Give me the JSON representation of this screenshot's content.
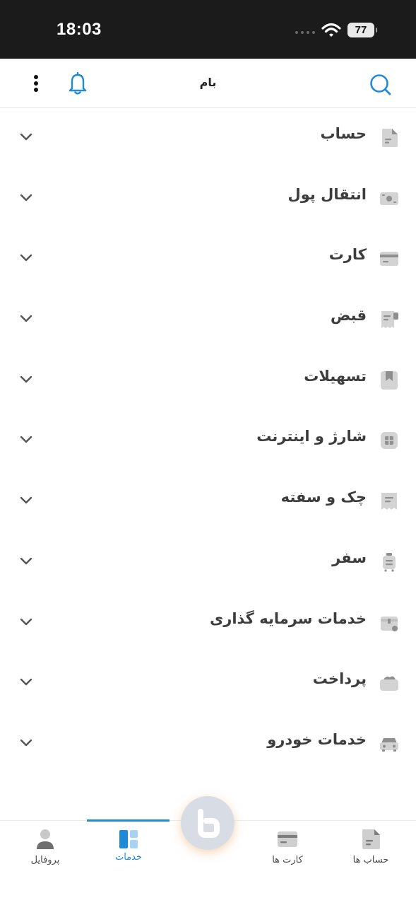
{
  "status_bar": {
    "time": "18:03",
    "battery": "77"
  },
  "header": {
    "title": "بام"
  },
  "menu": [
    {
      "label": "حساب",
      "icon": "document-icon"
    },
    {
      "label": "انتقال پول",
      "icon": "money-transfer-icon"
    },
    {
      "label": "کارت",
      "icon": "card-icon"
    },
    {
      "label": "قبض",
      "icon": "bill-icon"
    },
    {
      "label": "تسهیلات",
      "icon": "bookmark-icon"
    },
    {
      "label": "شارژ و اینترنت",
      "icon": "sim-card-icon"
    },
    {
      "label": "چک و سفته",
      "icon": "check-icon"
    },
    {
      "label": "سفر",
      "icon": "luggage-icon"
    },
    {
      "label": "خدمات سرمایه گذاری",
      "icon": "investment-icon"
    },
    {
      "label": "پرداخت",
      "icon": "wallet-icon"
    },
    {
      "label": "خدمات خودرو",
      "icon": "car-icon"
    }
  ],
  "bottom_nav": {
    "items": [
      {
        "label": "پروفایل",
        "icon": "profile-icon"
      },
      {
        "label": "خدمات",
        "icon": "services-icon",
        "active": true
      },
      {
        "label": "کارت ها",
        "icon": "card-icon"
      },
      {
        "label": "حساب ها",
        "icon": "document-icon"
      }
    ]
  },
  "colors": {
    "accent": "#1f8ad8",
    "icon_gray": "#cfcfcf",
    "text": "#3d3d3d"
  }
}
